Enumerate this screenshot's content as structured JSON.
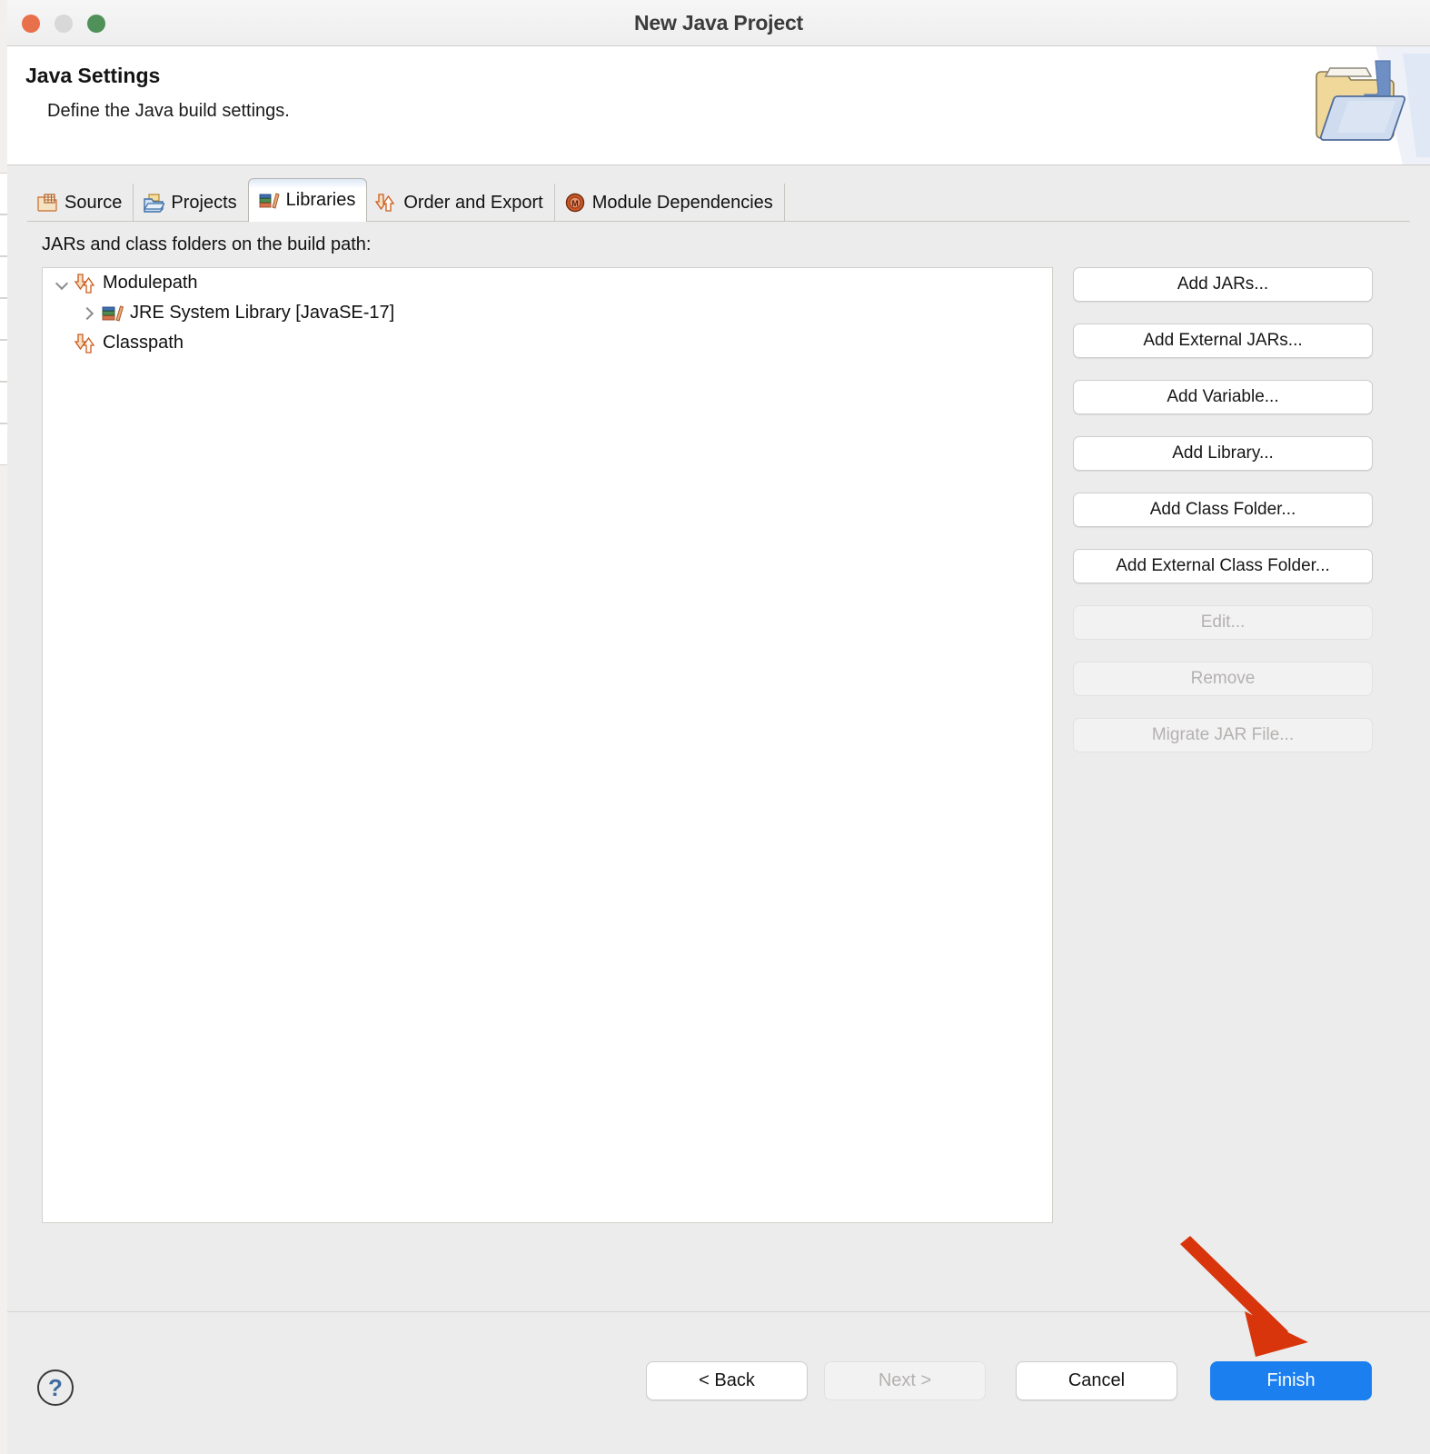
{
  "window": {
    "title": "New Java Project",
    "traffic_lights": [
      "close-button",
      "minimize-button",
      "maximize-button"
    ]
  },
  "header": {
    "title": "Java Settings",
    "subtitle": "Define the Java build settings.",
    "banner_icon": "java-project-folder-icon"
  },
  "tabs": [
    {
      "label": "Source",
      "icon": "source-folder-icon",
      "selected": false
    },
    {
      "label": "Projects",
      "icon": "projects-folder-icon",
      "selected": false
    },
    {
      "label": "Libraries",
      "icon": "libraries-books-icon",
      "selected": true
    },
    {
      "label": "Order and Export",
      "icon": "order-export-arrows-icon",
      "selected": false
    },
    {
      "label": "Module Dependencies",
      "icon": "module-dependencies-icon",
      "selected": false
    }
  ],
  "main": {
    "content_label": "JARs and class folders on the build path:",
    "tree": [
      {
        "label": "Modulepath",
        "icon": "classpath-arrows-icon",
        "twisty": "down",
        "indent": 0
      },
      {
        "label": "JRE System Library [JavaSE-17]",
        "icon": "jre-library-icon",
        "twisty": "right",
        "indent": 1
      },
      {
        "label": "Classpath",
        "icon": "classpath-arrows-icon",
        "twisty": "blank",
        "indent": 0
      }
    ]
  },
  "side_buttons": [
    {
      "label": "Add JARs...",
      "enabled": true
    },
    {
      "label": "Add External JARs...",
      "enabled": true
    },
    {
      "label": "Add Variable...",
      "enabled": true
    },
    {
      "label": "Add Library...",
      "enabled": true
    },
    {
      "label": "Add Class Folder...",
      "enabled": true
    },
    {
      "label": "Add External Class Folder...",
      "enabled": true
    },
    {
      "label": "Edit...",
      "enabled": false
    },
    {
      "label": "Remove",
      "enabled": false
    },
    {
      "label": "Migrate JAR File...",
      "enabled": false
    }
  ],
  "footer": {
    "help_icon": "help-question-icon",
    "back_label": "< Back",
    "next_label": "Next >",
    "cancel_label": "Cancel",
    "finish_label": "Finish"
  },
  "annotation": {
    "type": "arrow",
    "points_to": "finish-button",
    "color": "#d8350d"
  },
  "colors": {
    "accent_blue": "#1b7ff0",
    "dialog_bg": "#ececec",
    "panel_white": "#ffffff",
    "annotation_red": "#d8350d",
    "traffic_close": "#e8704a",
    "traffic_min": "#d8d8d8",
    "traffic_max": "#4f9159"
  }
}
